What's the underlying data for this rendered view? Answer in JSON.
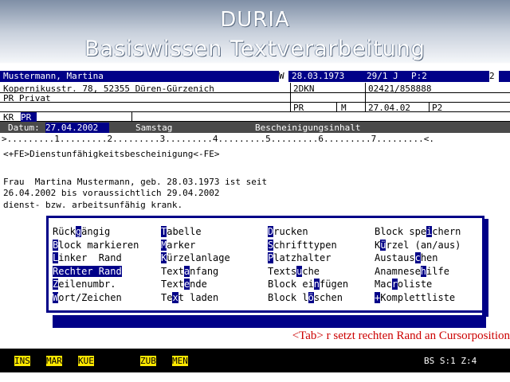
{
  "header": {
    "title": "DURIA",
    "subtitle": "Basiswissen Textverarbeitung"
  },
  "patient": {
    "name": "Mustermann, Martina",
    "sex": "W",
    "birthdate": "28.03.1973",
    "age_info": "29/1 J",
    "page_info": "P:2",
    "corner": "2",
    "address": "Kopernikusstr. 78, 52355 Düren-Gürzenich",
    "code1": "2DKN",
    "phone": "02421/858888",
    "insurance": "PR Privat",
    "ins_code": "PR",
    "ins_flag": "M",
    "ins_date": "27.04.02",
    "ins_p": "P2",
    "kr_label": "KR",
    "kr_value": "PR"
  },
  "datebar": {
    "label": "Datum:",
    "date": "27.04.2002",
    "weekday": "Samstag",
    "doc_title": "Bescheinigungsinhalt"
  },
  "ruler": ">.........1.........2.........3.........4.........5.........6.........7.........<.",
  "document": {
    "line1": "<+FE>Dienstunfähigkeitsbescheinigung<-FE>",
    "line2": "",
    "line3": "Frau  Martina Mustermann, geb. 28.03.1973 ist seit",
    "line4": "26.04.2002 bis voraussichtlich 29.04.2002",
    "line5": "dienst- bzw. arbeitsunfähig krank."
  },
  "menu": {
    "col1": [
      {
        "pre": "Rück",
        "key": "g",
        "post": "ängig"
      },
      {
        "pre": "",
        "key": "B",
        "post": "lock markieren"
      },
      {
        "pre": "",
        "key": "L",
        "post": "inker  Rand"
      },
      {
        "pre": "",
        "key": "",
        "post": "Rechter Rand"
      },
      {
        "pre": "",
        "key": "Z",
        "post": "eilenumbr."
      },
      {
        "pre": "",
        "key": "W",
        "post": "ort/Zeichen"
      }
    ],
    "col2": [
      {
        "pre": "",
        "key": "T",
        "post": "abelle"
      },
      {
        "pre": "",
        "key": "M",
        "post": "arker"
      },
      {
        "pre": "",
        "key": "K",
        "post": "ürzelanlage"
      },
      {
        "pre": "Text",
        "key": "a",
        "post": "nfang"
      },
      {
        "pre": "Text",
        "key": "e",
        "post": "nde"
      },
      {
        "pre": "Te",
        "key": "x",
        "post": "t laden"
      }
    ],
    "col3": [
      {
        "pre": "",
        "key": "D",
        "post": "rucken"
      },
      {
        "pre": "",
        "key": "S",
        "post": "chrifttypen"
      },
      {
        "pre": "",
        "key": "P",
        "post": "latzhalter"
      },
      {
        "pre": "Texts",
        "key": "u",
        "post": "che"
      },
      {
        "pre": "Block ei",
        "key": "n",
        "post": "fügen"
      },
      {
        "pre": "Block l",
        "key": "ö",
        "post": "schen"
      }
    ],
    "col4": [
      {
        "pre": "Block spe",
        "key": "i",
        "post": "chern"
      },
      {
        "pre": "K",
        "key": "ü",
        "post": "rzel (an/aus)"
      },
      {
        "pre": "Austaus",
        "key": "c",
        "post": "hen"
      },
      {
        "pre": "Anamnese",
        "key": "h",
        "post": "ilfe"
      },
      {
        "pre": "Mac",
        "key": "r",
        "post": "oliste"
      },
      {
        "pre": "",
        "key": "+",
        "post": "Komplettliste"
      }
    ]
  },
  "hint": "<Tab> r setzt rechten Rand an Cursorposition",
  "status": {
    "ins": "INS",
    "mar": "MAR",
    "kue": "KUE",
    "zub": "ZUB",
    "men": "MEN",
    "pos": "BS S:1 Z:4"
  }
}
